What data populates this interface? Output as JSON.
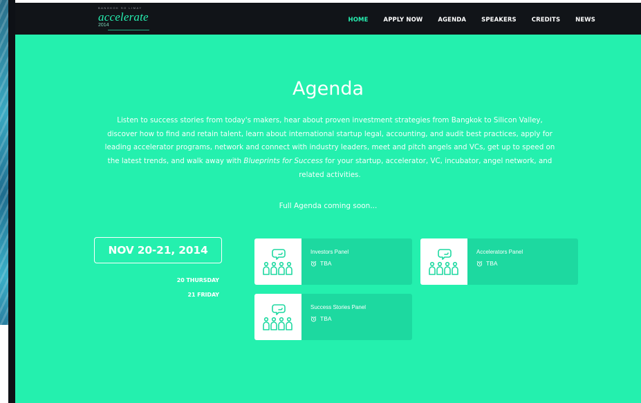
{
  "brand": {
    "tagline": "BANGKOK   SO   LIMAY",
    "logo_word": "accelerate",
    "logo_year": "2014"
  },
  "nav": {
    "items": [
      {
        "label": "HOME",
        "active": true
      },
      {
        "label": "APPLY NOW",
        "active": false
      },
      {
        "label": "AGENDA",
        "active": false
      },
      {
        "label": "SPEAKERS",
        "active": false
      },
      {
        "label": "CREDITS",
        "active": false
      },
      {
        "label": "NEWS",
        "active": false
      }
    ]
  },
  "agenda": {
    "title": "Agenda",
    "intro_part1": "Listen to success stories from today's makers, hear about proven investment strategies from Bangkok to Silicon Valley, discover how to find and retain talent, learn about international startup legal, accounting, and audit best practices, apply for leading accelerator programs, network and connect with industry leaders, meet and pitch angels and VCs, get up to speed on the latest trends, and walk away with ",
    "intro_emphasis": "Blueprints for Success",
    "intro_part2": " for your startup, accelerator, VC, incubator, angel network, and related activities.",
    "coming_soon": "Full Agenda coming soon...",
    "date_range": "NOV 20-21, 2014",
    "days": [
      "20 THURSDAY",
      "21 FRIDAY"
    ],
    "sessions": [
      {
        "name": "Investors Panel",
        "time": "TBA",
        "icon": "panel-audience-icon"
      },
      {
        "name": "Accelerators Panel",
        "time": "TBA",
        "icon": "panel-audience-icon"
      },
      {
        "name": "Success Stories Panel",
        "time": "TBA",
        "icon": "panel-audience-icon"
      }
    ]
  },
  "colors": {
    "accent": "#24f0ae",
    "navbar": "#111418",
    "card": "#1dd9a0",
    "text": "#ffffff"
  }
}
